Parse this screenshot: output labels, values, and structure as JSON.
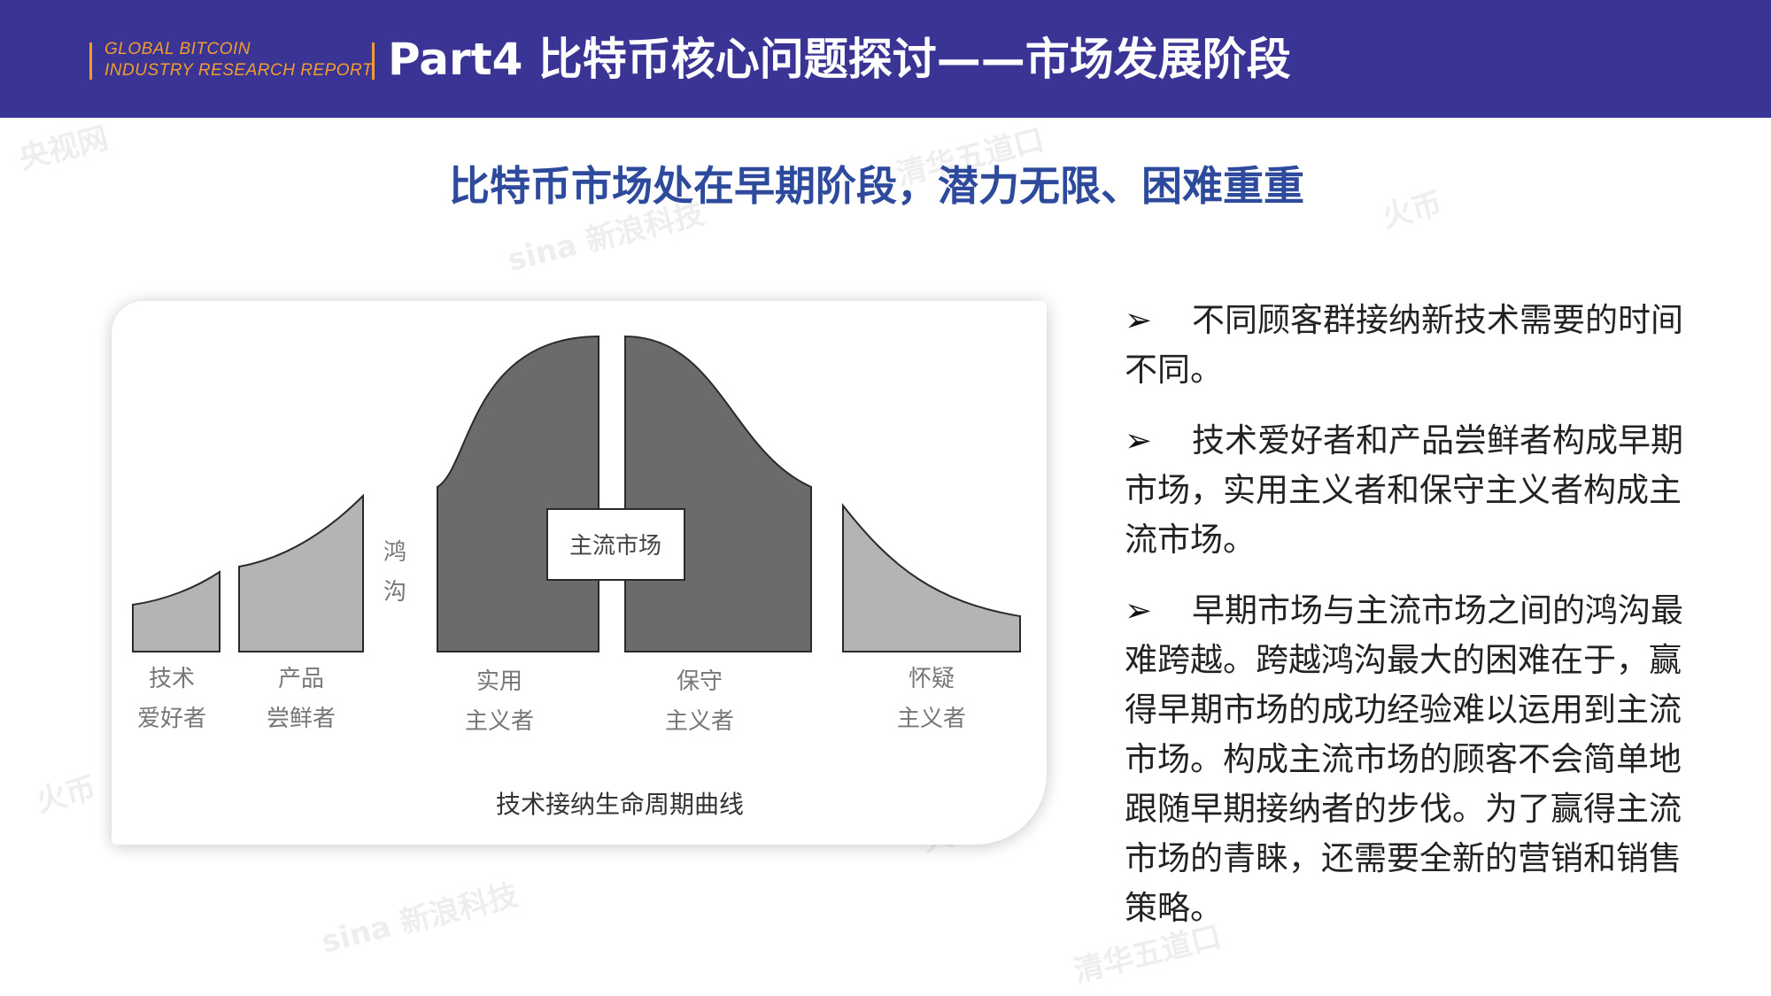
{
  "header": {
    "brand_line1": "GLOBAL BITCOIN",
    "brand_line2": "INDUSTRY RESEARCH REPORT",
    "title": "Part4 比特币核心问题探讨——市场发展阶段"
  },
  "subtitle": "比特币市场处在早期阶段，潜力无限、困难重重",
  "diagram": {
    "groups": [
      {
        "line1": "技术",
        "line2": "爱好者"
      },
      {
        "line1": "产品",
        "line2": "尝鲜者"
      },
      {
        "line1": "实用",
        "line2": "主义者"
      },
      {
        "line1": "保守",
        "line2": "主义者"
      },
      {
        "line1": "怀疑",
        "line2": "主义者"
      }
    ],
    "chasm_line1": "鸿",
    "chasm_line2": "沟",
    "mainstream_label": "主流市场",
    "caption": "技术接纳生命周期曲线",
    "colors": {
      "light": "#b4b4b4",
      "dark": "#6b6b6b",
      "stroke": "#2a2a2a"
    }
  },
  "bullets": {
    "marker": "➢",
    "items": [
      "不同顾客群接纳新技术需要的时间不同。",
      "技术爱好者和产品尝鲜者构成早期市场，实用主义者和保守主义者构成主流市场。",
      "早期市场与主流市场之间的鸿沟最难跨越。跨越鸿沟最大的困难在于，赢得早期市场的成功经验难以运用到主流市场。构成主流市场的顾客不会简单地跟随早期接纳者的步伐。为了赢得主流市场的青睐，还需要全新的营销和销售策略。"
    ]
  },
  "watermarks": [
    "央视网",
    "sina 新浪科技",
    "清华五道口",
    "火币"
  ]
}
